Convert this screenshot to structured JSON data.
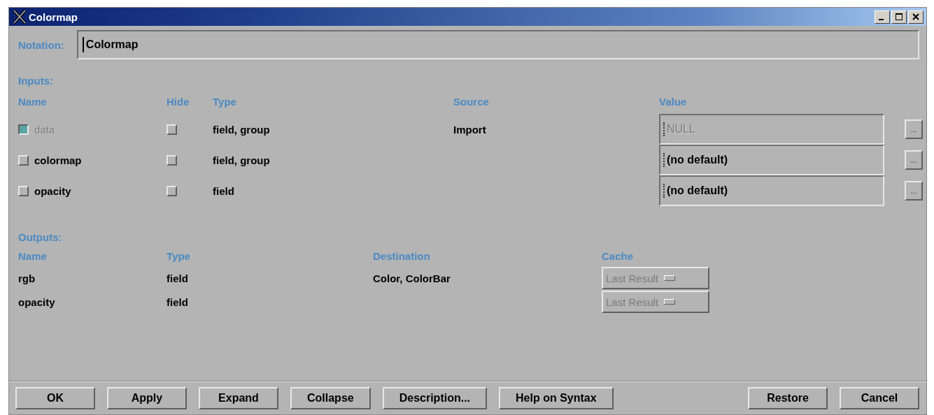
{
  "window": {
    "title": "Colormap"
  },
  "notation": {
    "label": "Notation:",
    "value": "Colormap"
  },
  "inputs": {
    "heading": "Inputs:",
    "columns": [
      "Name",
      "Hide",
      "Type",
      "Source",
      "Value"
    ],
    "rows": [
      {
        "name": "data",
        "checked": true,
        "disabled": true,
        "hide_checked": false,
        "type": "field, group",
        "source": "Import",
        "value": "NULL",
        "value_disabled": true,
        "browse": "..."
      },
      {
        "name": "colormap",
        "checked": false,
        "disabled": false,
        "hide_checked": false,
        "type": "field, group",
        "value": "(no default)",
        "value_disabled": false,
        "browse": "..."
      },
      {
        "name": "opacity",
        "checked": false,
        "disabled": false,
        "hide_checked": false,
        "type": "field",
        "value": "(no default)",
        "value_disabled": false,
        "browse": "..."
      }
    ]
  },
  "outputs": {
    "heading": "Outputs:",
    "columns": [
      "Name",
      "Type",
      "Destination",
      "Cache"
    ],
    "rows": [
      {
        "name": "rgb",
        "type": "field",
        "destination": "Color, ColorBar",
        "cache": "Last Result",
        "cache_disabled": true
      },
      {
        "name": "opacity",
        "type": "field",
        "cache": "Last Result",
        "cache_disabled": true
      }
    ]
  },
  "buttons_left": [
    "OK",
    "Apply",
    "Expand",
    "Collapse",
    "Description...",
    "Help on Syntax"
  ],
  "buttons_right": [
    "Restore",
    "Cancel"
  ]
}
